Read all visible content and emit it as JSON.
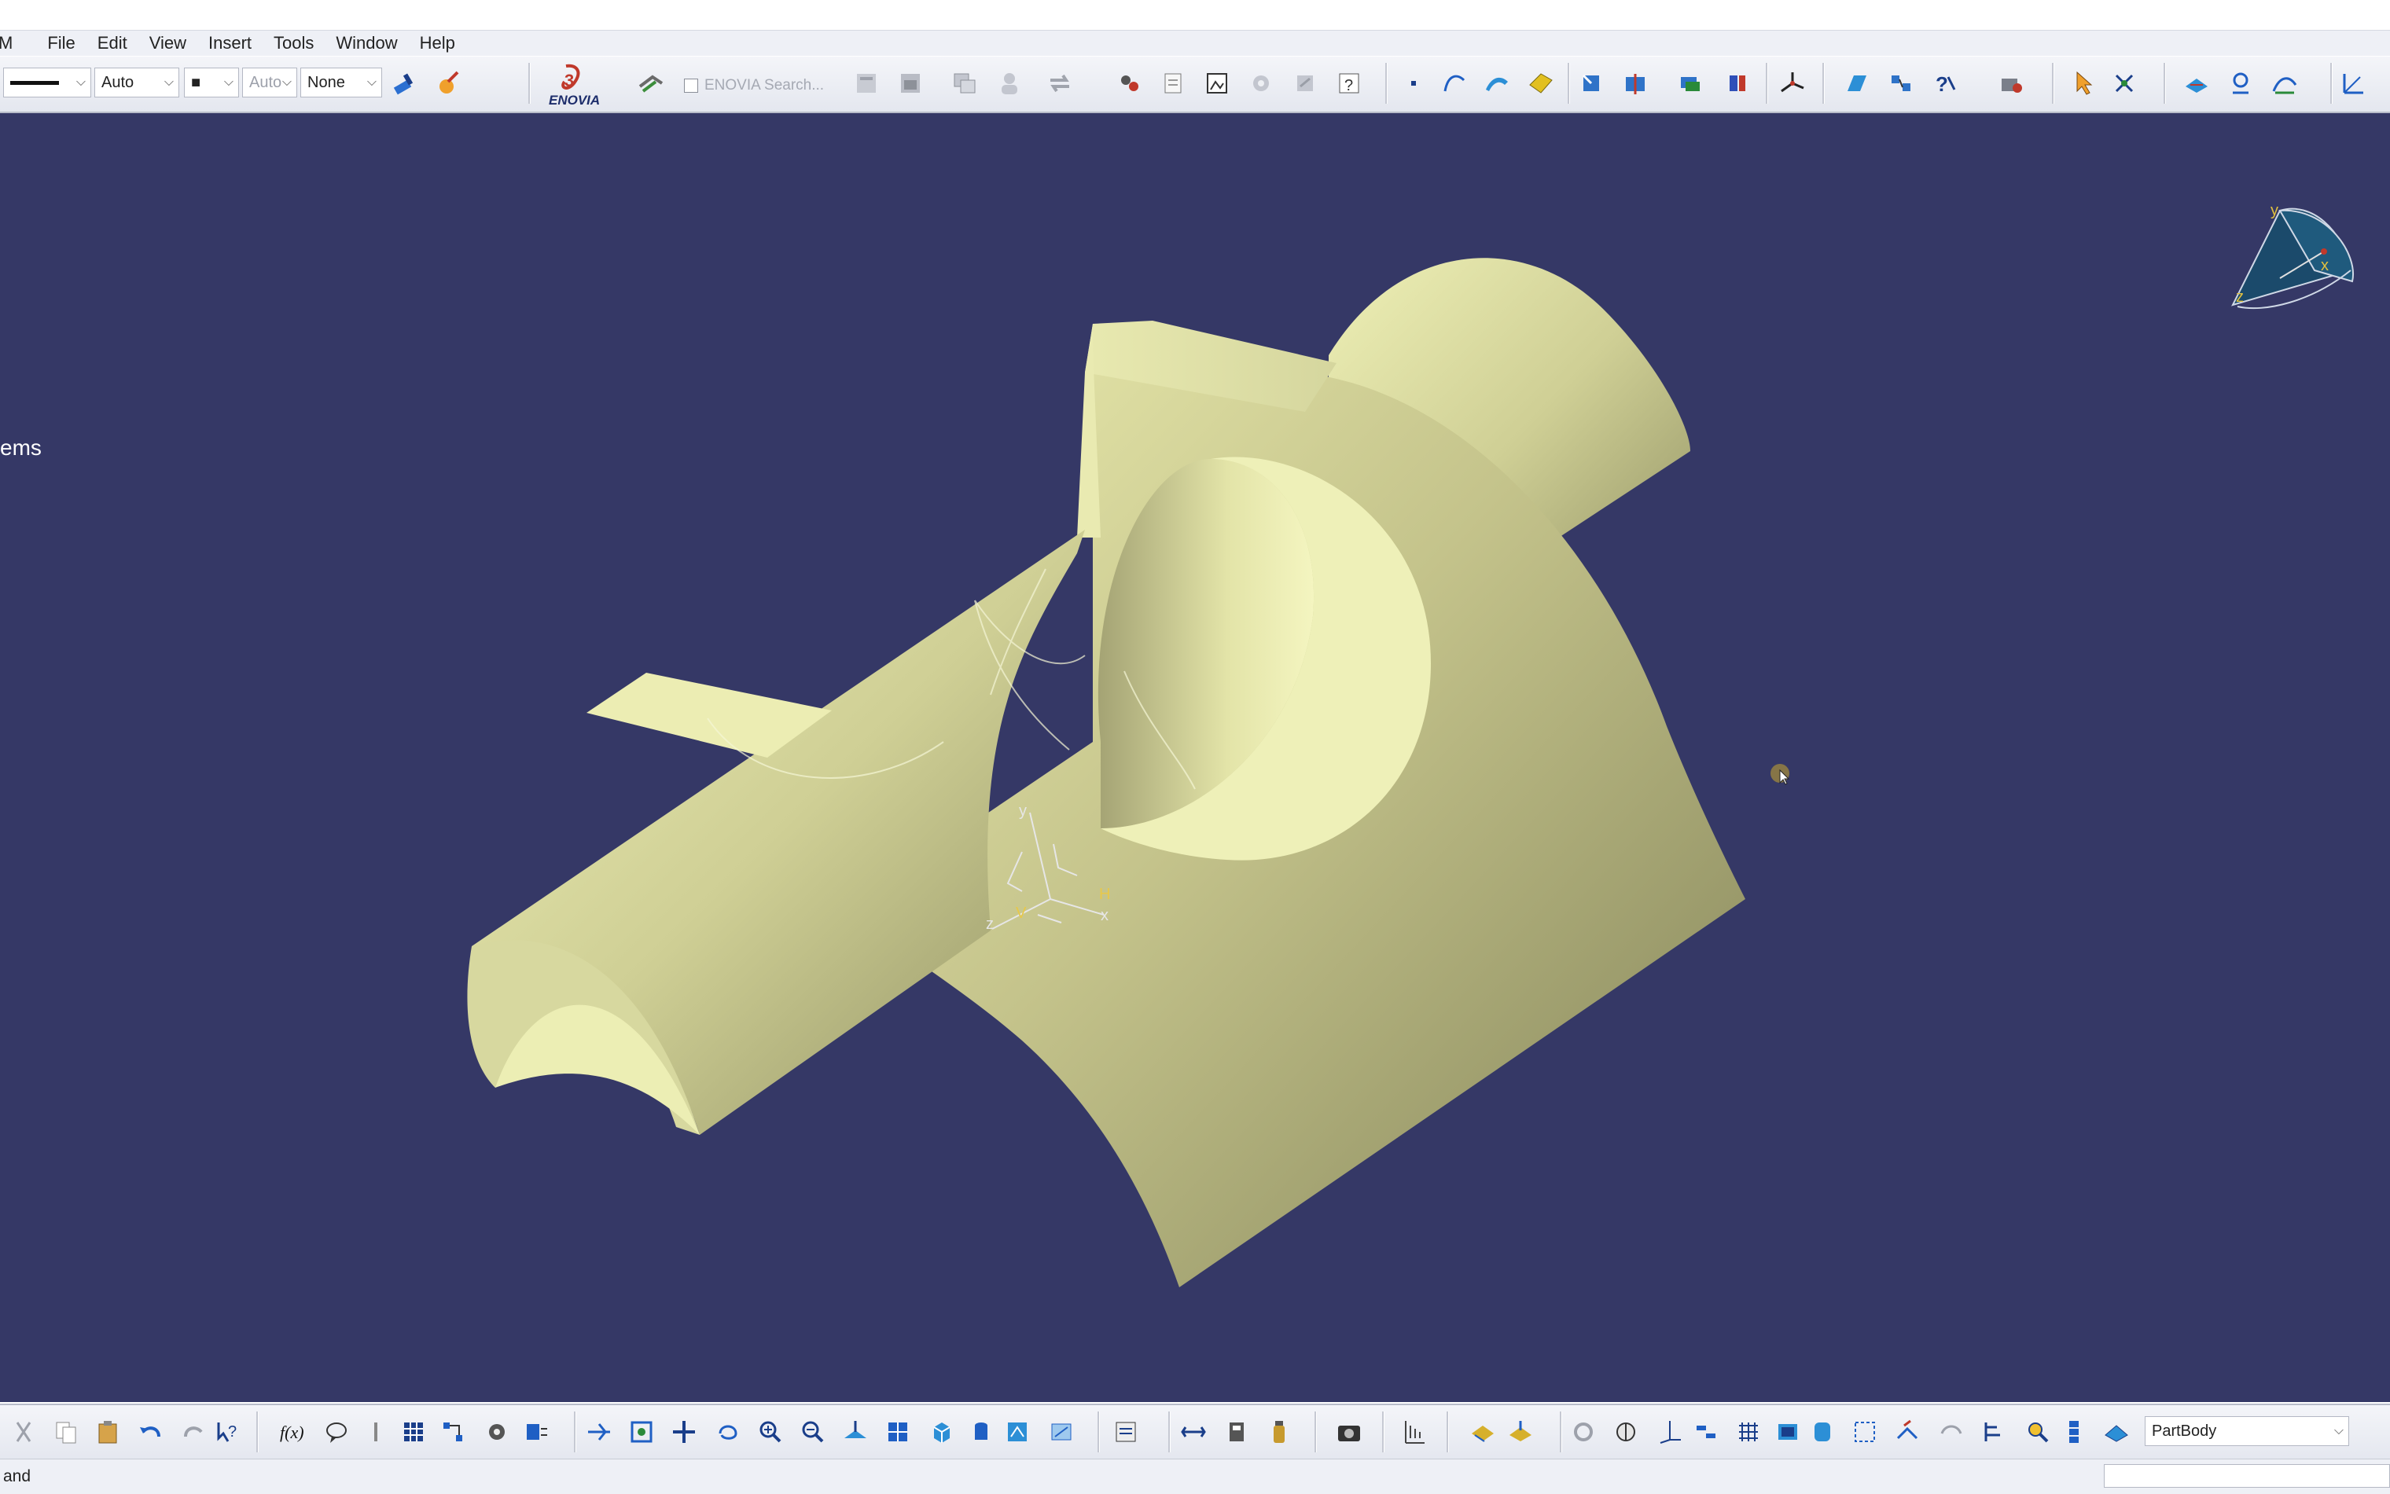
{
  "menu": {
    "items": [
      "M",
      "File",
      "Edit",
      "View",
      "Insert",
      "Tools",
      "Window",
      "Help"
    ]
  },
  "toolbar_top": {
    "line_type": "",
    "line_weight": "Auto",
    "point_type": "■",
    "layer": "Auto",
    "rendering": "None",
    "enovia_label": "ENOVIA",
    "enovia_search": "ENOVIA Search..."
  },
  "viewport": {
    "side_label": "ems",
    "background_color": "#353866",
    "part_color": "#e2e3a8"
  },
  "toolbar_bottom": {
    "active_body": "PartBody"
  },
  "compass": {
    "x": "x",
    "y": "y",
    "z": "z"
  },
  "axis_system": {
    "x": "x",
    "y": "y",
    "z": "z",
    "h": "H",
    "v": "V"
  },
  "statusbar": {
    "text": "and"
  }
}
